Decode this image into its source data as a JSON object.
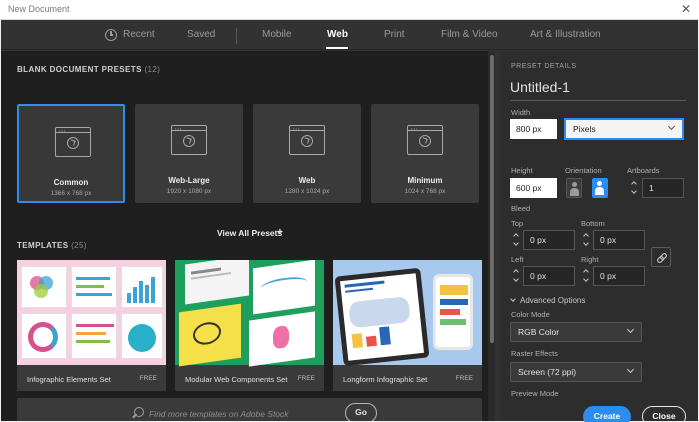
{
  "window": {
    "title": "New Document"
  },
  "tabs": [
    {
      "label": "Recent"
    },
    {
      "label": "Saved"
    },
    {
      "label": "Mobile"
    },
    {
      "label": "Web",
      "active": true
    },
    {
      "label": "Print"
    },
    {
      "label": "Film & Video"
    },
    {
      "label": "Art & Illustration"
    }
  ],
  "presets_section": {
    "title": "BLANK DOCUMENT PRESETS",
    "count": "(12)",
    "items": [
      {
        "name": "Common",
        "size": "1366 x 768 px",
        "selected": true
      },
      {
        "name": "Web-Large",
        "size": "1920 x 1080 px"
      },
      {
        "name": "Web",
        "size": "1280 x 1024 px"
      },
      {
        "name": "Minimum",
        "size": "1024 x 768 px"
      }
    ],
    "view_all_label": "View All Presets"
  },
  "templates_section": {
    "title": "TEMPLATES",
    "count": "(25)",
    "items": [
      {
        "name": "Infographic Elements Set",
        "badge": "FREE"
      },
      {
        "name": "Modular Web Components Set",
        "badge": "FREE"
      },
      {
        "name": "Longform Infographic Set",
        "badge": "FREE"
      }
    ]
  },
  "stock_search": {
    "placeholder": "Find more templates on Adobe Stock",
    "go_label": "Go"
  },
  "details": {
    "heading": "PRESET DETAILS",
    "doc_name": "Untitled-1",
    "width_label": "Width",
    "width_value": "800 px",
    "unit_value": "Pixels",
    "height_label": "Height",
    "height_value": "600 px",
    "orientation_label": "Orientation",
    "artboards_label": "Artboards",
    "artboards_value": "1",
    "bleed_label": "Bleed",
    "bleed_top_label": "Top",
    "bleed_top_value": "0 px",
    "bleed_bottom_label": "Bottom",
    "bleed_bottom_value": "0 px",
    "bleed_left_label": "Left",
    "bleed_left_value": "0 px",
    "bleed_right_label": "Right",
    "bleed_right_value": "0 px",
    "advanced_label": "Advanced Options",
    "color_mode_label": "Color Mode",
    "color_mode_value": "RGB Color",
    "raster_label": "Raster Effects",
    "raster_value": "Screen (72 ppi)",
    "preview_label": "Preview Mode",
    "create_label": "Create",
    "close_label": "Close"
  },
  "colors": {
    "accent": "#2d8cf0",
    "panel": "#1f1f1f",
    "chrome": "#323232"
  }
}
